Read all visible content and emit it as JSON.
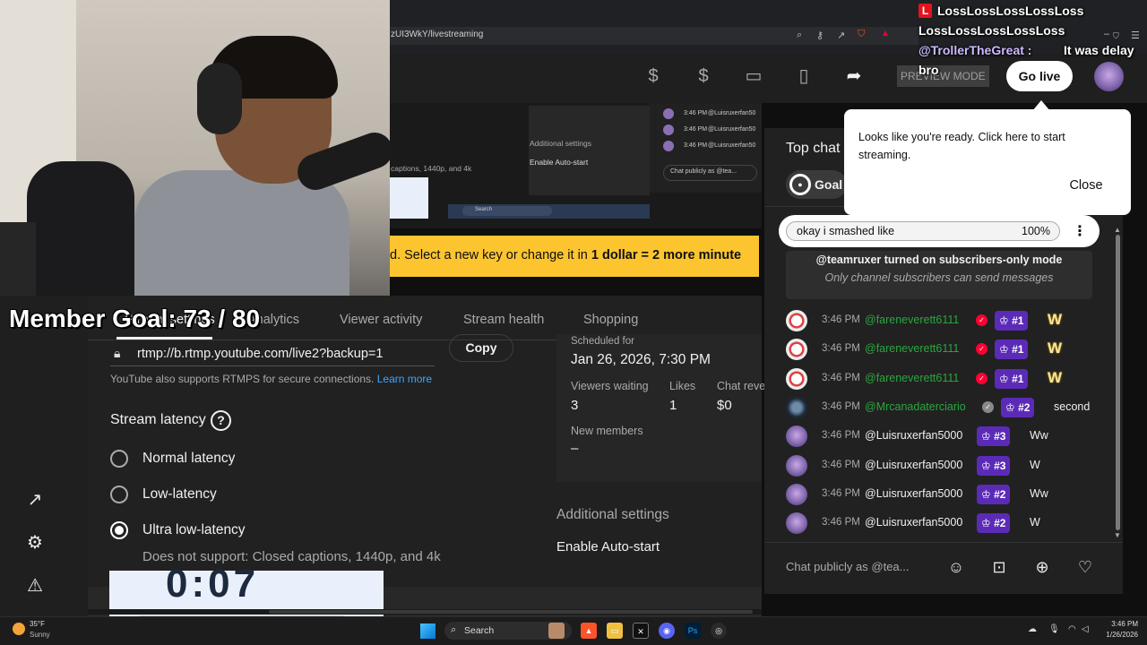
{
  "browser": {
    "url": "zUI3WkY/livestreaming"
  },
  "overlay": {
    "line1": "LossLossLossLossLoss",
    "line2": "LossLossLossLossLoss",
    "commenter": "@TrollerTheGreat :",
    "comment": "It was delay",
    "comment_cont": "bro",
    "member_goal": "Member Goal: 73 / 80"
  },
  "header": {
    "preview_mode": "PREVIEW MODE",
    "go_live": "Go live"
  },
  "tooltip": {
    "text": "Looks like you're ready. Click here to start streaming.",
    "close": "Close"
  },
  "banner": {
    "prefix": "d. Select a new key or change it in ",
    "bold": "1 dollar = 2 more minute"
  },
  "mirror": {
    "addl": "Additional settings",
    "auto": "Enable Auto-start",
    "captions": "captions, 1440p, and 4k",
    "chat_time": "3:46 PM",
    "chat_user": "@Luisruxerfan50",
    "chat_input": "Chat publicly as @tea...",
    "search": "Search"
  },
  "tabs": [
    "Stream settings",
    "Analytics",
    "Viewer activity",
    "Stream health",
    "Shopping"
  ],
  "stream_settings": {
    "rtmp_url": "rtmp://b.rtmp.youtube.com/live2?backup=1",
    "copy": "Copy",
    "rtmps_note": "YouTube also supports RTMPS for secure connections.",
    "learn_more": "Learn more",
    "latency_title": "Stream latency",
    "latency_options": [
      "Normal latency",
      "Low-latency",
      "Ultra low-latency"
    ],
    "selected_latency": 2,
    "ull_note": "Does not support: Closed captions, 1440p, and 4k",
    "clock": "0:07"
  },
  "stats": {
    "scheduled_label": "Scheduled for",
    "scheduled_date": "Jan 26, 2026, 7:30 PM",
    "viewers_waiting_label": "Viewers waiting",
    "viewers_waiting": "3",
    "likes_label": "Likes",
    "likes": "1",
    "chat_revenue_label": "Chat reve",
    "chat_revenue": "$0",
    "new_members_label": "New members",
    "new_members": "–",
    "additional_settings": "Additional settings",
    "enable_auto_start": "Enable Auto-start"
  },
  "chat": {
    "title": "Top chat",
    "goal_chip": "Goal",
    "pinned_text": "okay i smashed like",
    "pinned_pct": "100%",
    "system_line1": "@teamruxer turned on subscribers-only mode",
    "system_line2": "Only channel subscribers can send messages",
    "messages": [
      {
        "time": "3:46 PM",
        "author": "@fareneverett6111",
        "verified": "red",
        "badge": "#1",
        "text": "W",
        "big": true,
        "author_color": "#2ba640"
      },
      {
        "time": "3:46 PM",
        "author": "@fareneverett6111",
        "verified": "red",
        "badge": "#1",
        "text": "W",
        "big": true,
        "author_color": "#2ba640"
      },
      {
        "time": "3:46 PM",
        "author": "@fareneverett6111",
        "verified": "red",
        "badge": "#1",
        "text": "W",
        "big": true,
        "author_color": "#2ba640"
      },
      {
        "time": "3:46 PM",
        "author": "@Mrcanadaterciario",
        "verified": "grey",
        "badge": "#2",
        "text": "second",
        "big": false,
        "author_color": "#2ba640"
      },
      {
        "time": "3:46 PM",
        "author": "@Luisruxerfan5000",
        "verified": "",
        "badge": "#3",
        "text": "Ww",
        "big": false,
        "author_color": "#f1f1f1"
      },
      {
        "time": "3:46 PM",
        "author": "@Luisruxerfan5000",
        "verified": "",
        "badge": "#3",
        "text": "W",
        "big": false,
        "author_color": "#f1f1f1"
      },
      {
        "time": "3:46 PM",
        "author": "@Luisruxerfan5000",
        "verified": "",
        "badge": "#2",
        "text": "Ww",
        "big": false,
        "author_color": "#f1f1f1"
      },
      {
        "time": "3:46 PM",
        "author": "@Luisruxerfan5000",
        "verified": "",
        "badge": "#2",
        "text": "W",
        "big": false,
        "author_color": "#f1f1f1"
      }
    ],
    "input_placeholder": "Chat publicly as @tea..."
  },
  "taskbar": {
    "temp": "35°F",
    "condition": "Sunny",
    "search": "Search",
    "time": "3:46 PM",
    "date": "1/26/2026"
  },
  "colors": {
    "go_live_bg": "#ffffff",
    "banner_bg": "#fcc42f",
    "member_badge": "#5b2bb8",
    "verified_red": "#ff0033",
    "link": "#3ea6ff"
  }
}
